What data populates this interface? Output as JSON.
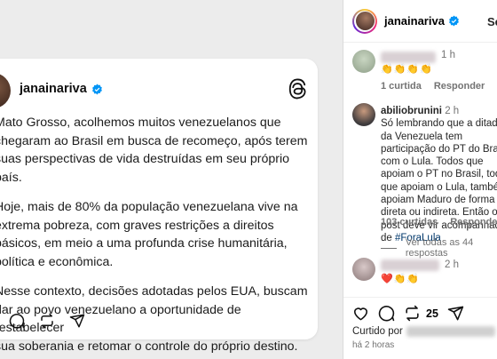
{
  "threads_post": {
    "username": "janainariva",
    "paragraphs": [
      "Mato Grosso, acolhemos muitos venezuelanos que\nchegaram ao Brasil em busca de recomeço, após terem\nsuas perspectivas de vida destruídas em seu próprio país.",
      "Hoje, mais de 80% da população venezuelana vive na\nextrema pobreza, com graves restrições a direitos\nbásicos, em meio a uma profunda crise humanitária,\npolítica e econômica.",
      "Nesse contexto, decisões adotadas pelos EUA, buscam\ndar ao povo venezuelano a oportunidade de restabelecer\nsua soberania e retomar o controle do próprio destino."
    ]
  },
  "instagram": {
    "header": {
      "username": "janainariva",
      "follow_label": "Seguir"
    },
    "comment1": {
      "time": "1 h",
      "emojis": "👏👏👏👏",
      "likes": "1 curtida",
      "reply": "Responder"
    },
    "comment2": {
      "username": "abiliobrunini",
      "time": "2 h",
      "text": "Só lembrando que a ditadura da Venezuela tem participação do PT do Brasil com o Lula. Todos que apoiam o PT no Brasil, todos que apoiam o Lula, também apoiam Maduro de forma direta ou indireta. Então o post deve vir acompanhado de",
      "hashtag": "#ForaLula",
      "likes": "103 curtidas",
      "reply": "Responder",
      "view_all": "Ver todas as 44 respostas"
    },
    "comment3": {
      "time": "2 h",
      "emojis": "❤️👏👏"
    },
    "footer": {
      "repost_count": "25",
      "liked_by": "Curtido por",
      "ago": "há 2 horas"
    }
  }
}
